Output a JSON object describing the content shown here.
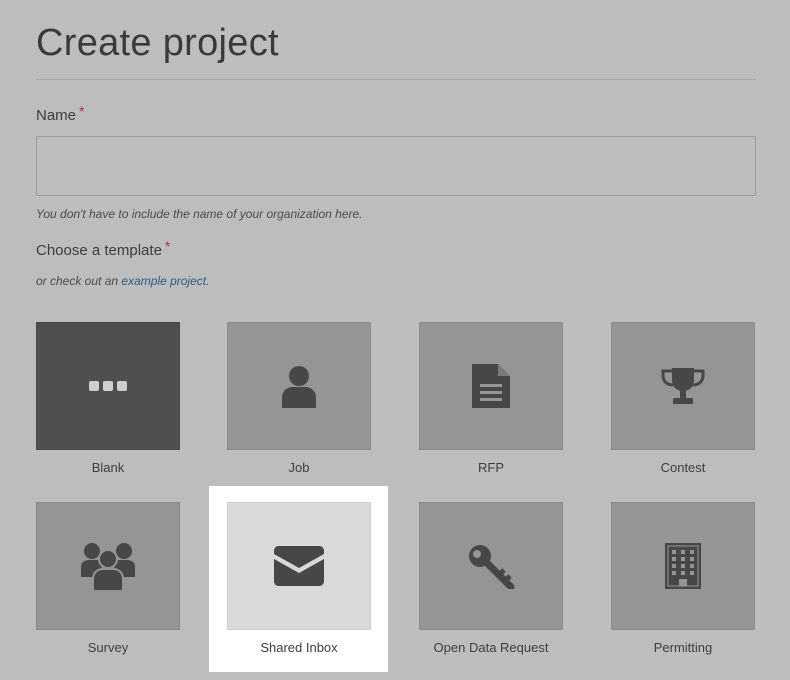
{
  "page": {
    "title": "Create project"
  },
  "name_field": {
    "label": "Name",
    "required_mark": "*",
    "value": "",
    "placeholder": "",
    "hint": "You don't have to include the name of your organization here."
  },
  "template_field": {
    "label": "Choose a template",
    "required_mark": "*",
    "hint_prefix": "or check out an ",
    "hint_link": "example project",
    "hint_suffix": "."
  },
  "templates": [
    {
      "label": "Blank",
      "icon": "ellipsis-icon",
      "state": "selected"
    },
    {
      "label": "Job",
      "icon": "user-icon",
      "state": "default"
    },
    {
      "label": "RFP",
      "icon": "document-icon",
      "state": "default"
    },
    {
      "label": "Contest",
      "icon": "trophy-icon",
      "state": "default"
    },
    {
      "label": "Survey",
      "icon": "group-icon",
      "state": "default"
    },
    {
      "label": "Shared Inbox",
      "icon": "envelope-icon",
      "state": "highlighted"
    },
    {
      "label": "Open Data Request",
      "icon": "key-icon",
      "state": "default"
    },
    {
      "label": "Permitting",
      "icon": "building-icon",
      "state": "default"
    }
  ],
  "colors": {
    "overlay_background": "#bdbdbd",
    "tile_default": "#959595",
    "tile_selected": "#4f4f4f",
    "tile_highlight": "#d9d9d9",
    "link": "#2a5b85",
    "required": "#c62828",
    "icon": "#474747"
  }
}
